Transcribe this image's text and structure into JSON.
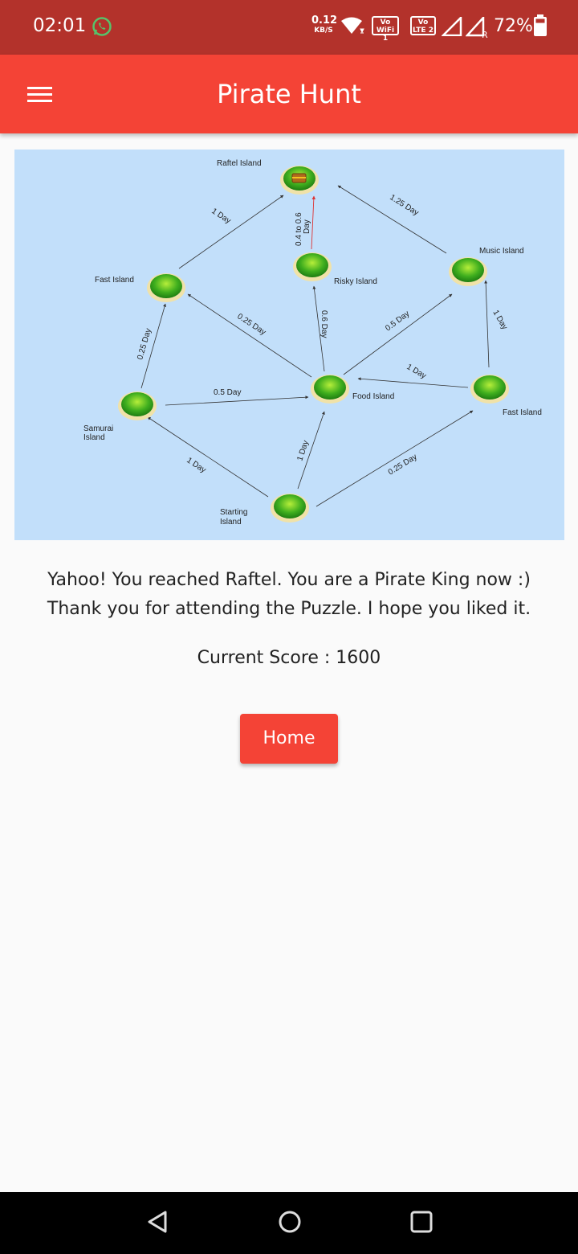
{
  "status_bar": {
    "time": "02:01",
    "net_speed_value": "0.12",
    "net_speed_unit": "KB/S",
    "vowifi_line1": "Vo",
    "vowifi_line2": "WiFi 1",
    "volte_line1": "Vo",
    "volte_line2": "LTE 2",
    "roaming": "R",
    "battery": "72%",
    "icons": [
      "whatsapp-icon",
      "wifi-icon",
      "signal-icon",
      "battery-icon"
    ]
  },
  "app_bar": {
    "title": "Pirate Hunt",
    "color": "#f44336",
    "menu_icon": "hamburger-menu-icon"
  },
  "map": {
    "islands": {
      "raftel": "Raftel Island",
      "risky": "Risky Island",
      "music": "Music Island",
      "fast_left": "Fast Island",
      "fast_right": "Fast Island",
      "food": "Food Island",
      "samurai_l1": "Samurai",
      "samurai_l2": "Island",
      "starting_l1": "Starting",
      "starting_l2": "Island"
    },
    "routes": {
      "fast_to_raftel": "1 Day",
      "music_to_raftel": "1.25 Day",
      "risky_to_raftel_l1": "0.4 to 0.6",
      "risky_to_raftel_l2": "Day",
      "food_to_fast": "0.25 Day",
      "food_to_risky": "0.6 Day",
      "food_to_music": "0.5 Day",
      "fast_to_music": "1 Day",
      "fast_to_food": "1 Day",
      "samurai_to_fast": "0.25 Day",
      "samurai_to_food": "0.5 Day",
      "start_to_samurai": "1 Day",
      "start_to_food": "1 Day",
      "start_to_fast": "0.25 Day"
    }
  },
  "message": {
    "line1": "Yahoo! You reached Raftel. You are a Pirate King now :)",
    "line2": "Thank you for attending the Puzzle. I hope you liked it."
  },
  "score": {
    "label": "Current Score : 1600"
  },
  "home_button": {
    "label": "Home"
  },
  "nav_bar": {
    "icons": [
      "back-icon",
      "home-circle-icon",
      "recents-icon"
    ]
  }
}
